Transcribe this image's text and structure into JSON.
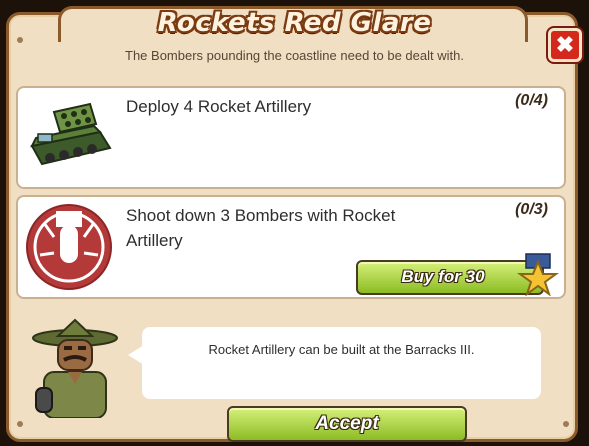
{
  "dialog": {
    "title": "Rockets Red Glare",
    "subtitle": "The Bombers pounding the coastline need to be dealt with.",
    "close_label": "✖"
  },
  "tasks": [
    {
      "text": "Deploy 4 Rocket Artillery",
      "progress": "(0/4)",
      "icon": "rocket-artillery-icon"
    },
    {
      "text": "Shoot down 3 Bombers with Rocket Artillery",
      "progress": "(0/3)",
      "icon": "bomber-target-icon"
    }
  ],
  "buy": {
    "label": "Buy for 30",
    "icon": "star-icon"
  },
  "hint": {
    "text": "Rocket Artillery can be built at the Barracks III."
  },
  "accept": {
    "label": "Accept"
  },
  "colors": {
    "panel": "#f1dfc4",
    "border": "#8a5a2b",
    "button": "#8cbc24",
    "close": "#d4281c",
    "target": "#b43a3a"
  }
}
